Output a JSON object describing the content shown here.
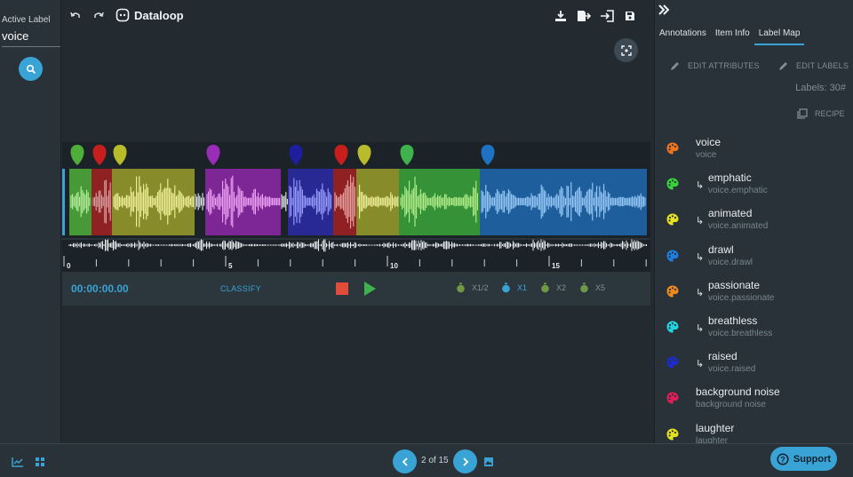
{
  "left_panel": {
    "title": "Active Label",
    "value": "voice"
  },
  "header": {
    "logo": "Dataloop"
  },
  "controls": {
    "timecode": "00:00:00.00",
    "classify": "CLASSIFY",
    "speeds": [
      "X1/2",
      "X1",
      "X2",
      "X5"
    ],
    "active_speed": "X1"
  },
  "timeline": {
    "ticks": [
      "0",
      "5",
      "10",
      "15"
    ]
  },
  "segments": [
    {
      "color": "#4fae3a",
      "marker": "#4fae3a"
    },
    {
      "color": "#a32121",
      "marker": "#c81e1e"
    },
    {
      "color": "#9a9d2a",
      "marker": "#b8bb2a"
    },
    {
      "color": "#8e27a8",
      "marker": "#9b2cb8"
    },
    {
      "color": "#2a2aa8",
      "marker": "#1d1d9e"
    },
    {
      "color": "#a32121",
      "marker": "#c81e1e"
    },
    {
      "color": "#9a9d2a",
      "marker": "#b8bb2a"
    },
    {
      "color": "#3aa63a",
      "marker": "#3fb24b"
    },
    {
      "color": "#1f68b2",
      "marker": "#1f72c2"
    }
  ],
  "right_panel": {
    "tabs": [
      "Annotations",
      "Item Info",
      "Label Map"
    ],
    "active_tab": "Label Map",
    "edit_attributes": "EDIT ATTRIBUTES",
    "edit_labels": "EDIT LABELS",
    "labels_count": "Labels: 30#",
    "recipe": "RECIPE",
    "labels": [
      {
        "name": "voice",
        "path": "voice",
        "color": "#f0741f",
        "child": false
      },
      {
        "name": "emphatic",
        "path": "voice.emphatic",
        "color": "#38d13a",
        "child": true
      },
      {
        "name": "animated",
        "path": "voice.animated",
        "color": "#e4e21e",
        "child": true
      },
      {
        "name": "drawl",
        "path": "voice.drawl",
        "color": "#1e7fe0",
        "child": true
      },
      {
        "name": "passionate",
        "path": "voice.passionate",
        "color": "#f08a1f",
        "child": true
      },
      {
        "name": "breathless",
        "path": "voice.breathless",
        "color": "#22d3e0",
        "child": true
      },
      {
        "name": "raised",
        "path": "voice.raised",
        "color": "#1d2bd0",
        "child": true
      },
      {
        "name": "background noise",
        "path": "background noise",
        "color": "#e01e5a",
        "child": false
      },
      {
        "name": "laughter",
        "path": "laughter",
        "color": "#e4e21e",
        "child": false
      }
    ]
  },
  "bottom_bar": {
    "pager": "2 of 15",
    "support": "Support"
  }
}
